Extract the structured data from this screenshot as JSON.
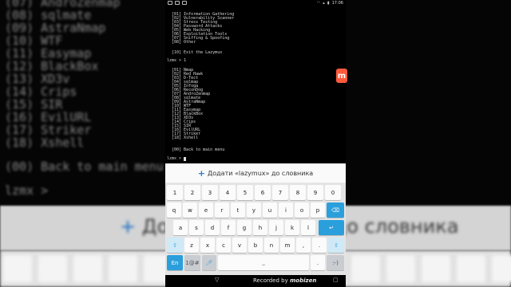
{
  "background": {
    "terminal_lines": [
      "(07) AndroZenmap",
      "(08) sqlmate",
      "(09) AstraNmap",
      "(10) WTF",
      "(11) Easymap",
      "(12) BlackBox",
      "(13) XD3v",
      "(14) Crips",
      "(15) SIR",
      "(16) EvilURL",
      "(17) Striker",
      "(18) Xshell",
      "",
      "(00) Back to main menu",
      "",
      "lzmx > "
    ],
    "suggestion": "Додати «lazymux» до словника"
  },
  "statusbar": {
    "time": "17:06"
  },
  "terminal": {
    "main_menu": [
      "[01] Information Gathering",
      "[02] Vulnerability Scanner",
      "[03] Stress Testing",
      "[04] Password Attacks",
      "[05] Web Hacking",
      "[06] Exploitation Tools",
      "[07] Sniffing & Spoofing",
      "[08] Other"
    ],
    "exit_option": "[10] Exit the Lazymux",
    "prompt1": "lzmx > 1",
    "tool_menu": [
      "[01] Nmap",
      "[02] Red Hawk",
      "[03] D-Tect",
      "[04] sqlmap",
      "[05] Infoga",
      "[06] ReconDog",
      "[07] AndroZenmap",
      "[08] sqlmate",
      "[09] AstraNmap",
      "[10] WTF",
      "[11] Easymap",
      "[12] BlackBox",
      "[13] XD3v",
      "[14] Crips",
      "[15] SIR",
      "[16] EvilURL",
      "[17] Striker",
      "[18] Xshell"
    ],
    "back_option": "[00] Back to main menu",
    "prompt2": "lzmx > "
  },
  "suggestion": {
    "text": "Додати «lazymux» до словника"
  },
  "keyboard": {
    "row_numbers": [
      "1",
      "2",
      "3",
      "4",
      "5",
      "6",
      "7",
      "8",
      "9",
      "0"
    ],
    "row1": [
      "q",
      "w",
      "e",
      "r",
      "t",
      "y",
      "u",
      "i",
      "o",
      "p"
    ],
    "row2": [
      "a",
      "s",
      "d",
      "f",
      "g",
      "h",
      "j",
      "k",
      "l"
    ],
    "row3": [
      "z",
      "x",
      "c",
      "v",
      "b",
      "n",
      "m"
    ],
    "lang_key": "En",
    "sym_key": "1@#",
    "smiley_key": ":-)"
  },
  "navbar": {
    "recorder_label": "Recorded by",
    "recorder_brand": "mobizen"
  }
}
